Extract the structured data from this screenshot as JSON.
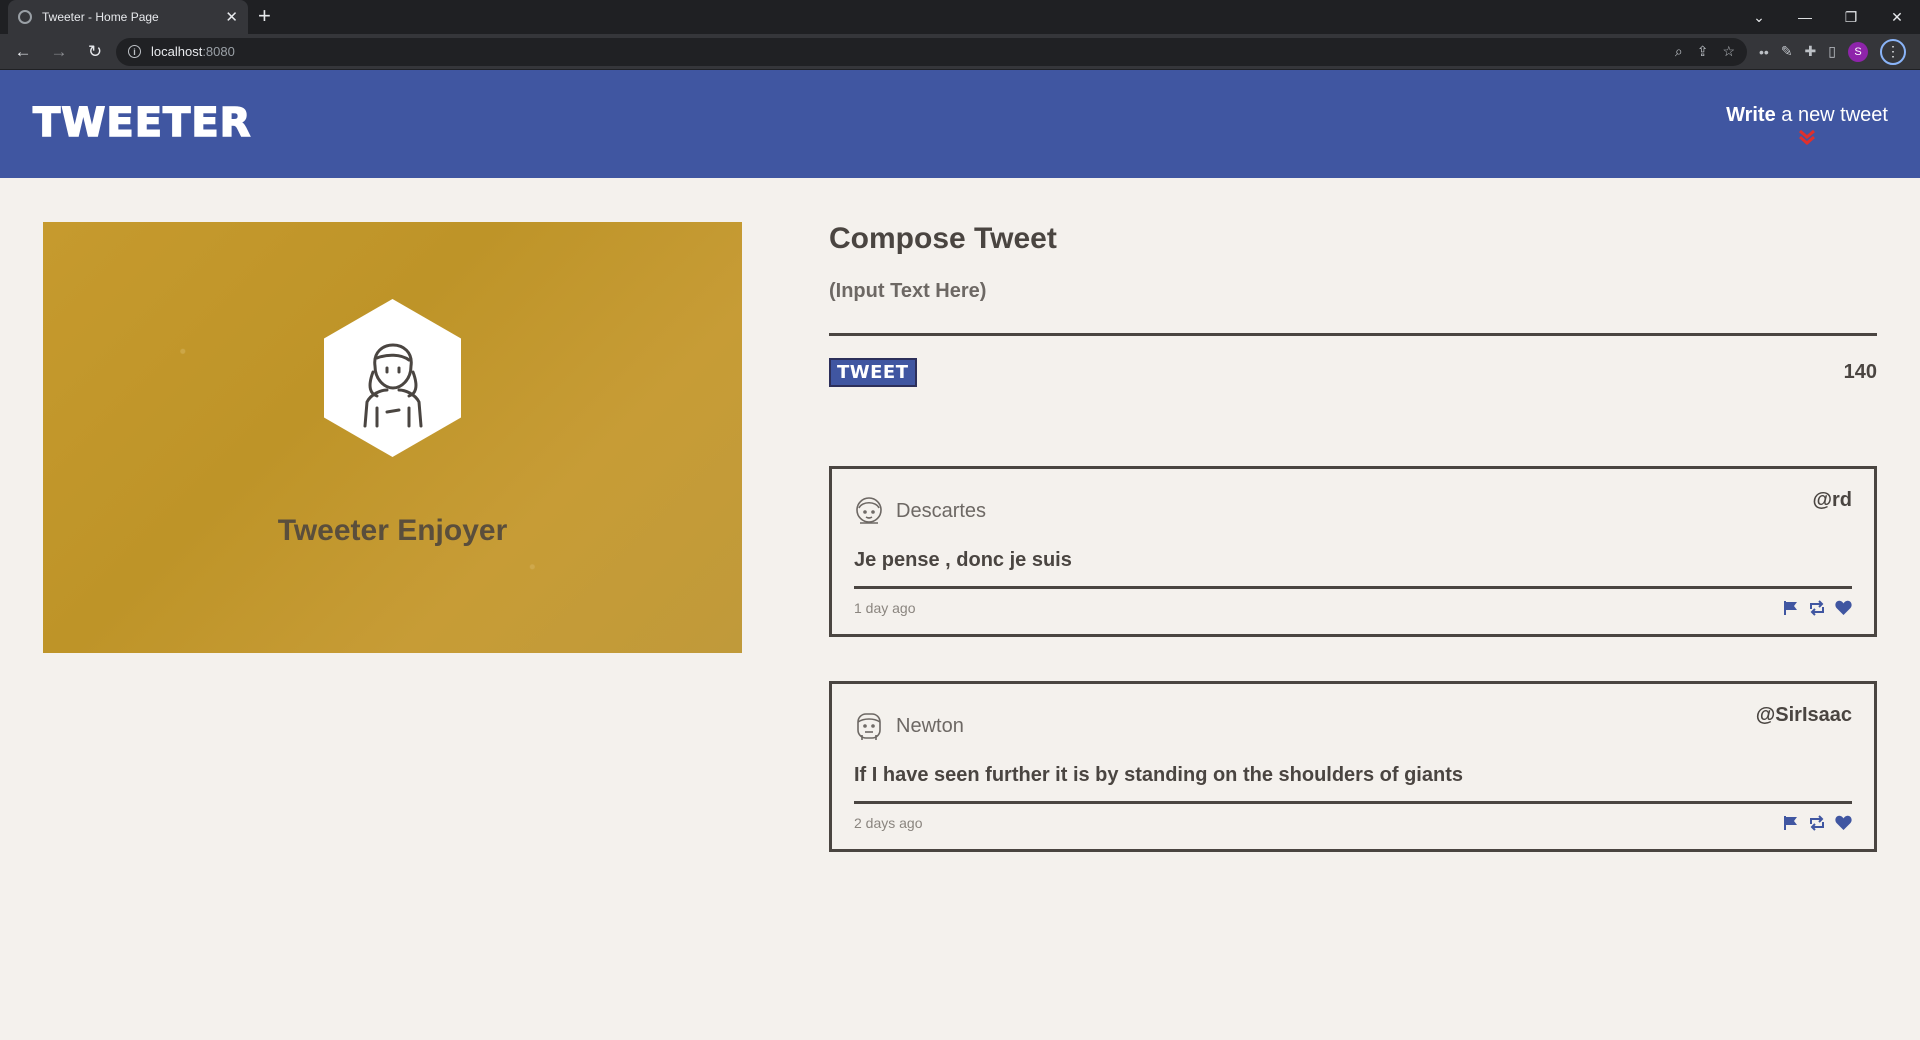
{
  "browser": {
    "tab_title": "Tweeter - Home Page",
    "tab_close": "✕",
    "new_tab": "+",
    "url_host": "localhost",
    "url_port": ":8080",
    "profile_initial": "S"
  },
  "header": {
    "logo": "TWEETER",
    "write_bold": "Write",
    "write_rest": " a new tweet"
  },
  "profile": {
    "name": "Tweeter Enjoyer",
    "avatar_icon": "user-avatar-icon"
  },
  "compose": {
    "title": "Compose Tweet",
    "placeholder": "(Input Text Here)",
    "button_label": "TWEET",
    "counter": "140"
  },
  "tweets": [
    {
      "name": "Descartes",
      "handle": "@rd",
      "content": "Je pense , donc je suis",
      "time": "1 day ago"
    },
    {
      "name": "Newton",
      "handle": "@SirIsaac",
      "content": "If I have seen further it is by standing on the shoulders of giants",
      "time": "2 days ago"
    }
  ],
  "colors": {
    "header_bg": "#4056a1",
    "page_bg": "#f4f1ed",
    "card_bg": "#c69a2e",
    "accent_red": "#e0302c",
    "text_dark": "#4a4541"
  }
}
